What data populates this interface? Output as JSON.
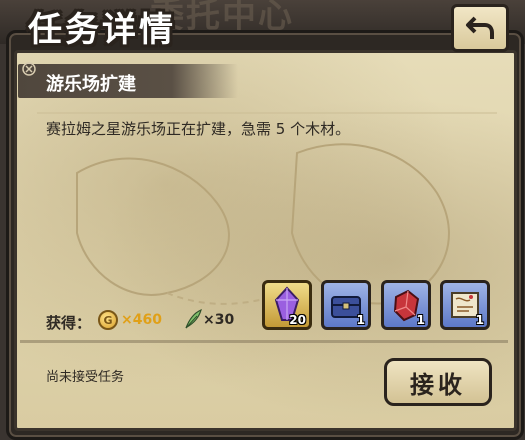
{
  "window": {
    "title": "任务详情",
    "background_title": "委托中心"
  },
  "mission": {
    "name": "游乐场扩建",
    "description": "赛拉姆之星游乐场正在扩建，急需 5 个木材。"
  },
  "rewards": {
    "label": "获得：",
    "currency": [
      {
        "icon": "gold-coin-icon",
        "symbol": "G",
        "value": "×460"
      },
      {
        "icon": "feather-icon",
        "value": "×30"
      }
    ],
    "items": [
      {
        "icon": "purple-crystal-icon",
        "count": "20",
        "frame": "gold"
      },
      {
        "icon": "treasure-chest-icon",
        "count": "1",
        "frame": "blue"
      },
      {
        "icon": "red-ore-icon",
        "count": "1",
        "frame": "blue"
      },
      {
        "icon": "scroll-map-icon",
        "count": "1",
        "frame": "blue"
      }
    ]
  },
  "status": {
    "text": "尚未接受任务"
  },
  "actions": {
    "accept_label": "接收",
    "back_icon": "return-arrow-icon"
  },
  "colors": {
    "parchment": "#e2d6b0",
    "coin_value": "#e0a018",
    "item_frame_blue": "#6f88d2",
    "item_frame_gold": "#d8b95a"
  }
}
